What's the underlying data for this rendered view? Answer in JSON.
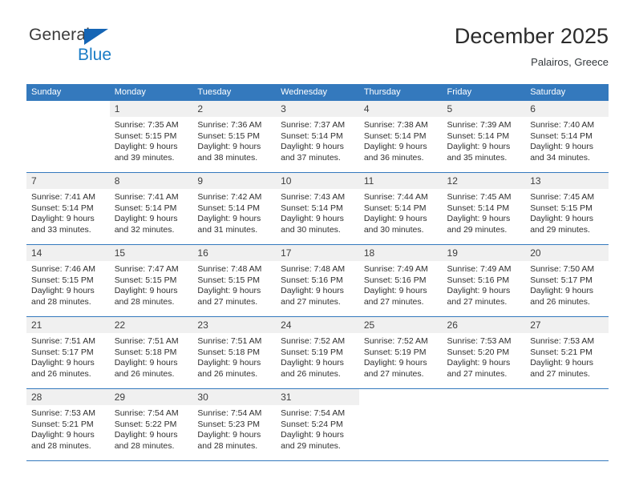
{
  "logo": {
    "word_one": "General",
    "word_two": "Blue",
    "triangle_color": "#1565b5",
    "word_two_color": "#1a7cc6"
  },
  "header": {
    "title": "December 2025",
    "location": "Palairos, Greece"
  },
  "theme": {
    "header_blue": "#3479bd",
    "daynum_strip": "#f0f0f0",
    "row_divider": "#3479bd"
  },
  "weekdays": [
    "Sunday",
    "Monday",
    "Tuesday",
    "Wednesday",
    "Thursday",
    "Friday",
    "Saturday"
  ],
  "weeks": [
    [
      {
        "day": "",
        "sunrise": "",
        "sunset": "",
        "daylight_1": "",
        "daylight_2": "",
        "blank": true
      },
      {
        "day": "1",
        "sunrise": "Sunrise: 7:35 AM",
        "sunset": "Sunset: 5:15 PM",
        "daylight_1": "Daylight: 9 hours",
        "daylight_2": "and 39 minutes."
      },
      {
        "day": "2",
        "sunrise": "Sunrise: 7:36 AM",
        "sunset": "Sunset: 5:15 PM",
        "daylight_1": "Daylight: 9 hours",
        "daylight_2": "and 38 minutes."
      },
      {
        "day": "3",
        "sunrise": "Sunrise: 7:37 AM",
        "sunset": "Sunset: 5:14 PM",
        "daylight_1": "Daylight: 9 hours",
        "daylight_2": "and 37 minutes."
      },
      {
        "day": "4",
        "sunrise": "Sunrise: 7:38 AM",
        "sunset": "Sunset: 5:14 PM",
        "daylight_1": "Daylight: 9 hours",
        "daylight_2": "and 36 minutes."
      },
      {
        "day": "5",
        "sunrise": "Sunrise: 7:39 AM",
        "sunset": "Sunset: 5:14 PM",
        "daylight_1": "Daylight: 9 hours",
        "daylight_2": "and 35 minutes."
      },
      {
        "day": "6",
        "sunrise": "Sunrise: 7:40 AM",
        "sunset": "Sunset: 5:14 PM",
        "daylight_1": "Daylight: 9 hours",
        "daylight_2": "and 34 minutes."
      }
    ],
    [
      {
        "day": "7",
        "sunrise": "Sunrise: 7:41 AM",
        "sunset": "Sunset: 5:14 PM",
        "daylight_1": "Daylight: 9 hours",
        "daylight_2": "and 33 minutes."
      },
      {
        "day": "8",
        "sunrise": "Sunrise: 7:41 AM",
        "sunset": "Sunset: 5:14 PM",
        "daylight_1": "Daylight: 9 hours",
        "daylight_2": "and 32 minutes."
      },
      {
        "day": "9",
        "sunrise": "Sunrise: 7:42 AM",
        "sunset": "Sunset: 5:14 PM",
        "daylight_1": "Daylight: 9 hours",
        "daylight_2": "and 31 minutes."
      },
      {
        "day": "10",
        "sunrise": "Sunrise: 7:43 AM",
        "sunset": "Sunset: 5:14 PM",
        "daylight_1": "Daylight: 9 hours",
        "daylight_2": "and 30 minutes."
      },
      {
        "day": "11",
        "sunrise": "Sunrise: 7:44 AM",
        "sunset": "Sunset: 5:14 PM",
        "daylight_1": "Daylight: 9 hours",
        "daylight_2": "and 30 minutes."
      },
      {
        "day": "12",
        "sunrise": "Sunrise: 7:45 AM",
        "sunset": "Sunset: 5:14 PM",
        "daylight_1": "Daylight: 9 hours",
        "daylight_2": "and 29 minutes."
      },
      {
        "day": "13",
        "sunrise": "Sunrise: 7:45 AM",
        "sunset": "Sunset: 5:15 PM",
        "daylight_1": "Daylight: 9 hours",
        "daylight_2": "and 29 minutes."
      }
    ],
    [
      {
        "day": "14",
        "sunrise": "Sunrise: 7:46 AM",
        "sunset": "Sunset: 5:15 PM",
        "daylight_1": "Daylight: 9 hours",
        "daylight_2": "and 28 minutes."
      },
      {
        "day": "15",
        "sunrise": "Sunrise: 7:47 AM",
        "sunset": "Sunset: 5:15 PM",
        "daylight_1": "Daylight: 9 hours",
        "daylight_2": "and 28 minutes."
      },
      {
        "day": "16",
        "sunrise": "Sunrise: 7:48 AM",
        "sunset": "Sunset: 5:15 PM",
        "daylight_1": "Daylight: 9 hours",
        "daylight_2": "and 27 minutes."
      },
      {
        "day": "17",
        "sunrise": "Sunrise: 7:48 AM",
        "sunset": "Sunset: 5:16 PM",
        "daylight_1": "Daylight: 9 hours",
        "daylight_2": "and 27 minutes."
      },
      {
        "day": "18",
        "sunrise": "Sunrise: 7:49 AM",
        "sunset": "Sunset: 5:16 PM",
        "daylight_1": "Daylight: 9 hours",
        "daylight_2": "and 27 minutes."
      },
      {
        "day": "19",
        "sunrise": "Sunrise: 7:49 AM",
        "sunset": "Sunset: 5:16 PM",
        "daylight_1": "Daylight: 9 hours",
        "daylight_2": "and 27 minutes."
      },
      {
        "day": "20",
        "sunrise": "Sunrise: 7:50 AM",
        "sunset": "Sunset: 5:17 PM",
        "daylight_1": "Daylight: 9 hours",
        "daylight_2": "and 26 minutes."
      }
    ],
    [
      {
        "day": "21",
        "sunrise": "Sunrise: 7:51 AM",
        "sunset": "Sunset: 5:17 PM",
        "daylight_1": "Daylight: 9 hours",
        "daylight_2": "and 26 minutes."
      },
      {
        "day": "22",
        "sunrise": "Sunrise: 7:51 AM",
        "sunset": "Sunset: 5:18 PM",
        "daylight_1": "Daylight: 9 hours",
        "daylight_2": "and 26 minutes."
      },
      {
        "day": "23",
        "sunrise": "Sunrise: 7:51 AM",
        "sunset": "Sunset: 5:18 PM",
        "daylight_1": "Daylight: 9 hours",
        "daylight_2": "and 26 minutes."
      },
      {
        "day": "24",
        "sunrise": "Sunrise: 7:52 AM",
        "sunset": "Sunset: 5:19 PM",
        "daylight_1": "Daylight: 9 hours",
        "daylight_2": "and 26 minutes."
      },
      {
        "day": "25",
        "sunrise": "Sunrise: 7:52 AM",
        "sunset": "Sunset: 5:19 PM",
        "daylight_1": "Daylight: 9 hours",
        "daylight_2": "and 27 minutes."
      },
      {
        "day": "26",
        "sunrise": "Sunrise: 7:53 AM",
        "sunset": "Sunset: 5:20 PM",
        "daylight_1": "Daylight: 9 hours",
        "daylight_2": "and 27 minutes."
      },
      {
        "day": "27",
        "sunrise": "Sunrise: 7:53 AM",
        "sunset": "Sunset: 5:21 PM",
        "daylight_1": "Daylight: 9 hours",
        "daylight_2": "and 27 minutes."
      }
    ],
    [
      {
        "day": "28",
        "sunrise": "Sunrise: 7:53 AM",
        "sunset": "Sunset: 5:21 PM",
        "daylight_1": "Daylight: 9 hours",
        "daylight_2": "and 28 minutes."
      },
      {
        "day": "29",
        "sunrise": "Sunrise: 7:54 AM",
        "sunset": "Sunset: 5:22 PM",
        "daylight_1": "Daylight: 9 hours",
        "daylight_2": "and 28 minutes."
      },
      {
        "day": "30",
        "sunrise": "Sunrise: 7:54 AM",
        "sunset": "Sunset: 5:23 PM",
        "daylight_1": "Daylight: 9 hours",
        "daylight_2": "and 28 minutes."
      },
      {
        "day": "31",
        "sunrise": "Sunrise: 7:54 AM",
        "sunset": "Sunset: 5:24 PM",
        "daylight_1": "Daylight: 9 hours",
        "daylight_2": "and 29 minutes."
      },
      {
        "day": "",
        "sunrise": "",
        "sunset": "",
        "daylight_1": "",
        "daylight_2": "",
        "blank": true
      },
      {
        "day": "",
        "sunrise": "",
        "sunset": "",
        "daylight_1": "",
        "daylight_2": "",
        "blank": true
      },
      {
        "day": "",
        "sunrise": "",
        "sunset": "",
        "daylight_1": "",
        "daylight_2": "",
        "blank": true
      }
    ]
  ]
}
